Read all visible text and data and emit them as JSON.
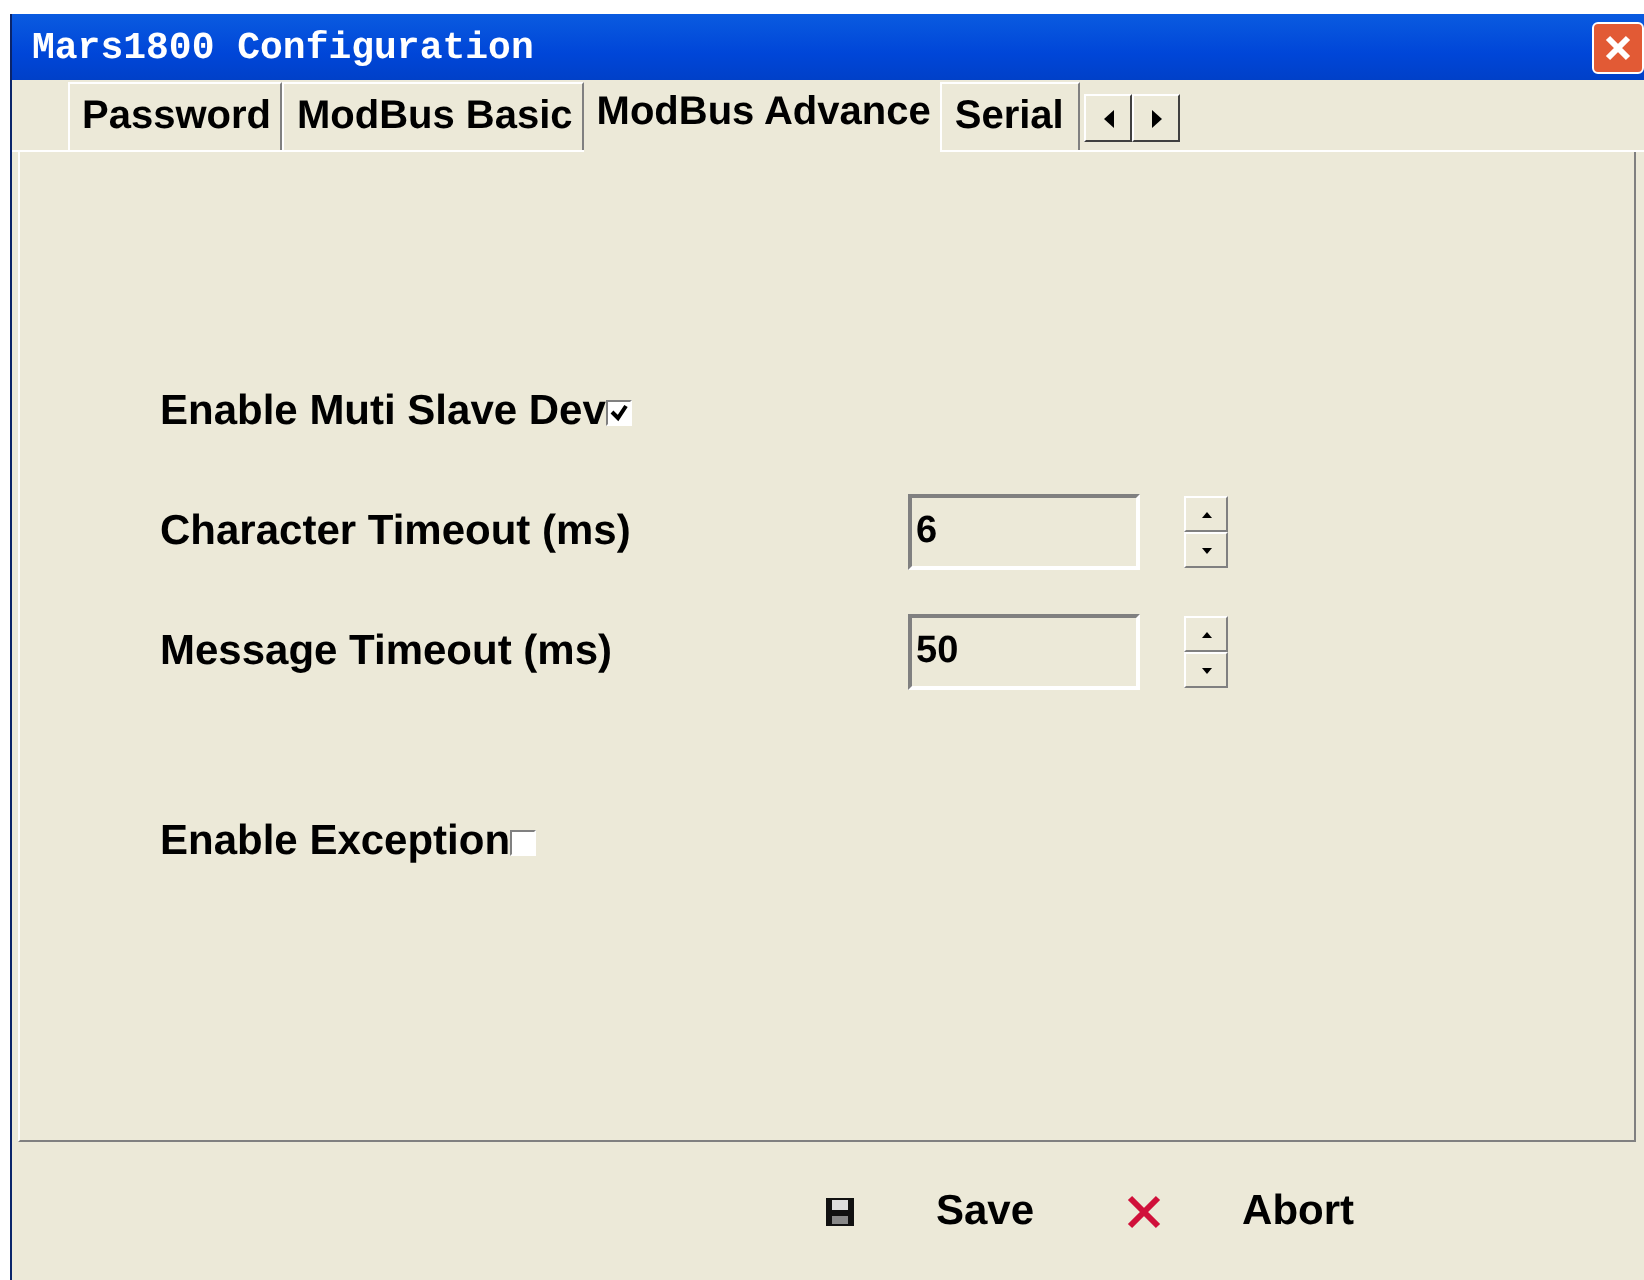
{
  "window": {
    "title": "Mars1800 Configuration"
  },
  "tabs": [
    {
      "label": "Password",
      "selected": false
    },
    {
      "label": "ModBus Basic",
      "selected": false
    },
    {
      "label": "ModBus Advance",
      "selected": true
    },
    {
      "label": "Serial",
      "selected": false
    }
  ],
  "settings": [
    {
      "kind": "checkbox",
      "label": "Enable Muti Slave Dev",
      "checked": true
    },
    {
      "kind": "spinner",
      "label": "Character Timeout (ms)",
      "value": "6"
    },
    {
      "kind": "spinner",
      "label": "Message Timeout (ms)",
      "value": "50"
    },
    {
      "kind": "checkbox",
      "label": "Enable Exception",
      "checked": false
    }
  ],
  "buttons": [
    {
      "kind": "save",
      "label": "Save"
    },
    {
      "kind": "abort",
      "label": "Abort"
    }
  ]
}
